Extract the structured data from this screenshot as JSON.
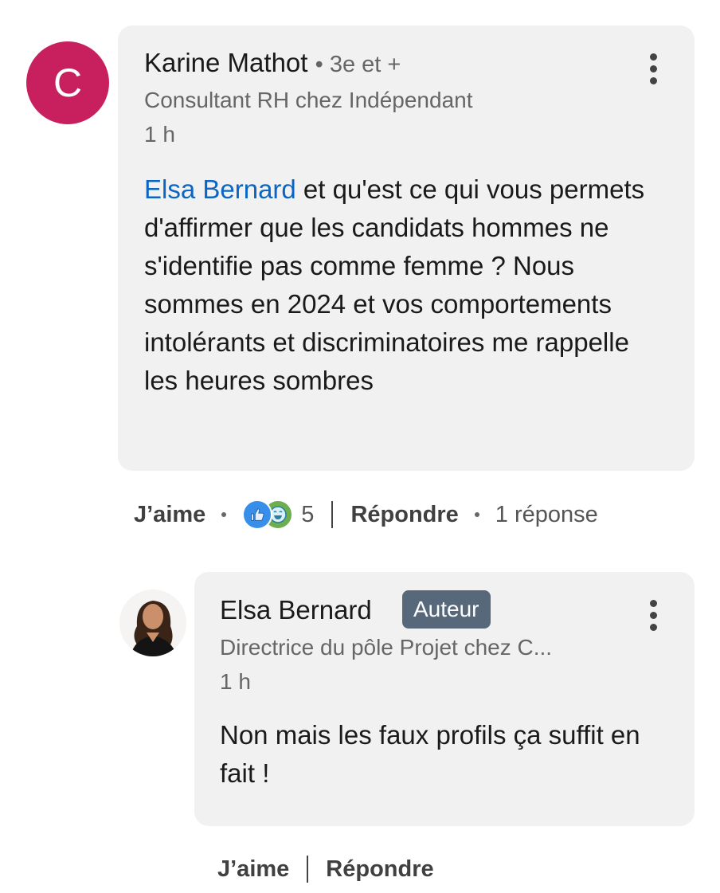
{
  "comment": {
    "avatar_letter": "C",
    "author": "Karine Mathot",
    "degree": "3e et +",
    "headline": "Consultant RH chez Indépendant",
    "time": "1 h",
    "mention": "Elsa Bernard",
    "text": " et qu'est ce qui vous permets d'affirmer que les candidats hommes ne s'identifie pas comme femme ? Nous sommes en 2024 et vos comportements intolérants et discriminatoires me rappelle les heures sombres",
    "actions": {
      "like": "J’aime",
      "reaction_count": "5",
      "reply": "Répondre",
      "replies": "1 réponse"
    }
  },
  "reply": {
    "author": "Elsa Bernard",
    "badge": "Auteur",
    "headline": "Directrice du pôle Projet chez C...",
    "time": "1 h",
    "text": "Non mais les faux profils ça suffit en fait !",
    "actions": {
      "like": "J’aime",
      "reply": "Répondre"
    }
  },
  "colors": {
    "avatar": "#c8205e",
    "mention": "#0a66c2",
    "badge": "#56687a",
    "bubble": "#f1f1f1"
  }
}
